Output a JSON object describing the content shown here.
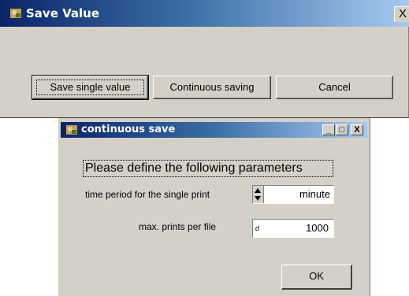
{
  "main_window": {
    "title": "Save Value",
    "close_glyph": "X",
    "icon": "app-icon",
    "buttons": {
      "save_single": "Save single value",
      "continuous": "Continuous saving",
      "cancel": "Cancel"
    }
  },
  "dialog": {
    "title": "continuous save",
    "icon": "app-icon",
    "controls": {
      "minimize": "_",
      "maximize": "□",
      "close": "X"
    },
    "heading": "Please define the following parameters",
    "time_period": {
      "label": "time period for the single print",
      "value": "minute"
    },
    "max_prints": {
      "label": "max. prints per file",
      "prefix": "d",
      "value": "1000"
    },
    "ok_label": "OK"
  },
  "colors": {
    "titlebar_start": "#0a246a",
    "titlebar_end": "#a6caf0",
    "face": "#d4d0c8"
  }
}
